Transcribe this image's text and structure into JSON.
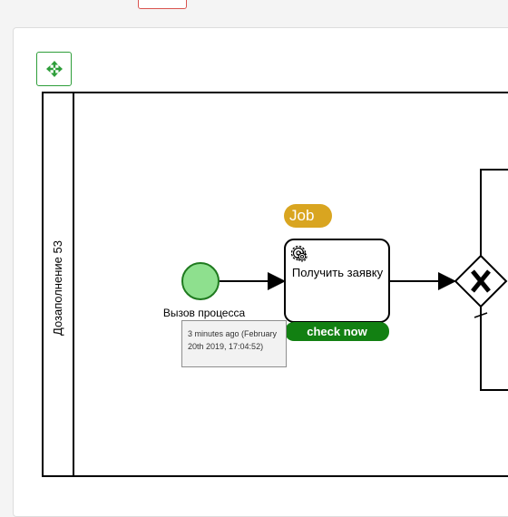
{
  "toolbar": {
    "move_icon": "move-arrows-icon",
    "accent_color": "#2e9e3a"
  },
  "pool": {
    "lane_label": "Дозаполнение 53"
  },
  "start_event": {
    "label": "Вызов процесса",
    "fill_color": "#8ee08e",
    "stroke_color": "#1f7a1f"
  },
  "task": {
    "label": "Получить заявку",
    "type_icon": "gear-icon"
  },
  "job_badge": {
    "label": "Job",
    "color": "#d9a520"
  },
  "check_now": {
    "label": "check now",
    "color": "#128012"
  },
  "tooltip": {
    "text": "3 minutes ago (February 20th 2019, 17:04:52)"
  },
  "gateway": {
    "type": "exclusive",
    "symbol": "X"
  }
}
